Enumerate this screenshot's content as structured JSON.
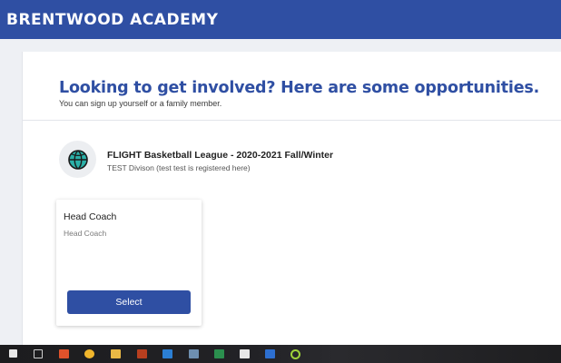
{
  "header": {
    "brand": "BRENTWOOD ACADEMY"
  },
  "main": {
    "headline": "Looking to get involved? Here are some opportunities.",
    "subline": "You can sign up yourself or a family member."
  },
  "league": {
    "icon": "basketball-icon",
    "title": "FLIGHT Basketball League - 2020-2021 Fall/Winter",
    "subtitle": "TEST Divison (test test is registered here)"
  },
  "opportunity": {
    "title": "Head Coach",
    "description": "Head Coach",
    "button_label": "Select"
  },
  "colors": {
    "brand": "#2f4fa3",
    "basketball": "#2bb0a8"
  },
  "taskbar": {
    "icons": [
      "start-icon",
      "task-view-icon",
      "app-icon",
      "chrome-icon",
      "file-explorer-icon",
      "illustrator-icon",
      "outlook-icon",
      "store-icon",
      "excel-icon",
      "acrobat-icon",
      "word-icon",
      "app-icon"
    ]
  }
}
